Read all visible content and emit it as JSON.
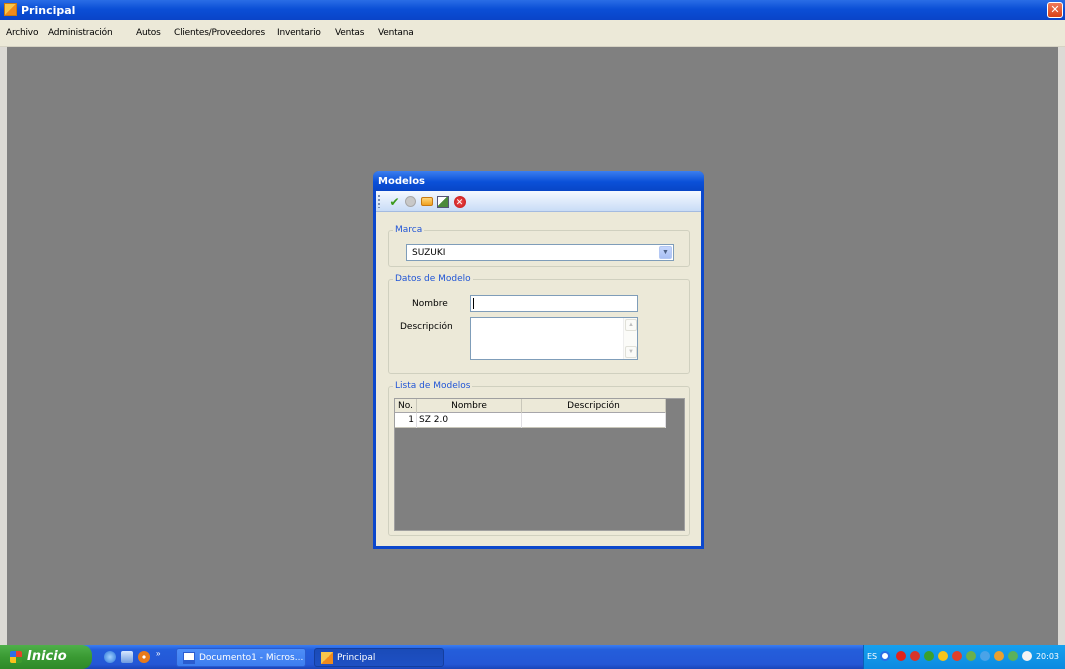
{
  "window": {
    "title": "Principal"
  },
  "menu": [
    "Archivo",
    "Administración",
    "Autos",
    "Clientes/Proveedores",
    "Inventario",
    "Ventas",
    "Ventana"
  ],
  "modelos": {
    "title": "Modelos",
    "toolbar_icons": [
      "check-icon",
      "disabled-circle-icon",
      "edit-icon",
      "export-icon",
      "close-circle-icon"
    ],
    "marca": {
      "legend": "Marca",
      "selected": "SUZUKI"
    },
    "datos": {
      "legend": "Datos de Modelo",
      "nombre_label": "Nombre",
      "nombre_value": "",
      "descripcion_label": "Descripción",
      "descripcion_value": ""
    },
    "lista": {
      "legend": "Lista de Modelos",
      "columns": [
        "No.",
        "Nombre",
        "Descripción"
      ],
      "rows": [
        {
          "no": "1",
          "nombre": "SZ 2.0",
          "descripcion": ""
        }
      ]
    }
  },
  "taskbar": {
    "start_label": "Inicio",
    "quick_launch_more": "»",
    "tasks": [
      {
        "label": "Documento1 - Micros...",
        "active": false
      },
      {
        "label": "Principal",
        "active": true
      }
    ],
    "tray_language": "ES",
    "clock": "20:03"
  }
}
